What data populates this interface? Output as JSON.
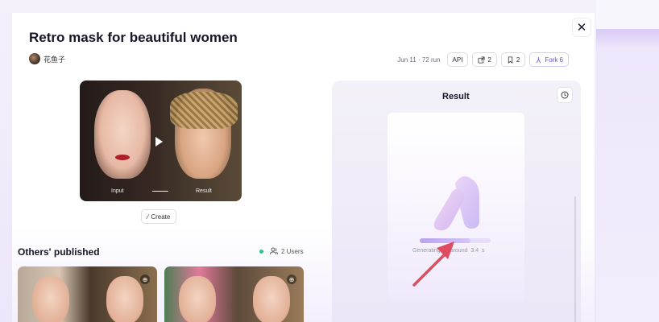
{
  "page": {
    "title": "Retro mask for beautiful women",
    "author": "花鱼子",
    "close_icon": "close-icon",
    "meta": {
      "date_runs": "Jun 11 · 72 run",
      "api_label": "API",
      "share_count": "2",
      "bookmark_count": "2",
      "fork_label": "Fork 6"
    }
  },
  "preview": {
    "input_label": "Input",
    "result_label": "Result"
  },
  "create_label": "Create",
  "others": {
    "title": "Others' published",
    "users_label": "2 Users"
  },
  "result": {
    "title": "Result",
    "generating_text": "Generating for around",
    "seconds": "3.4",
    "unit": "s",
    "progress_fraction": 0.72
  },
  "colors": {
    "accent": "#6a4bd8",
    "online": "#2bc48a",
    "annotation_arrow": "#e04b5e"
  }
}
